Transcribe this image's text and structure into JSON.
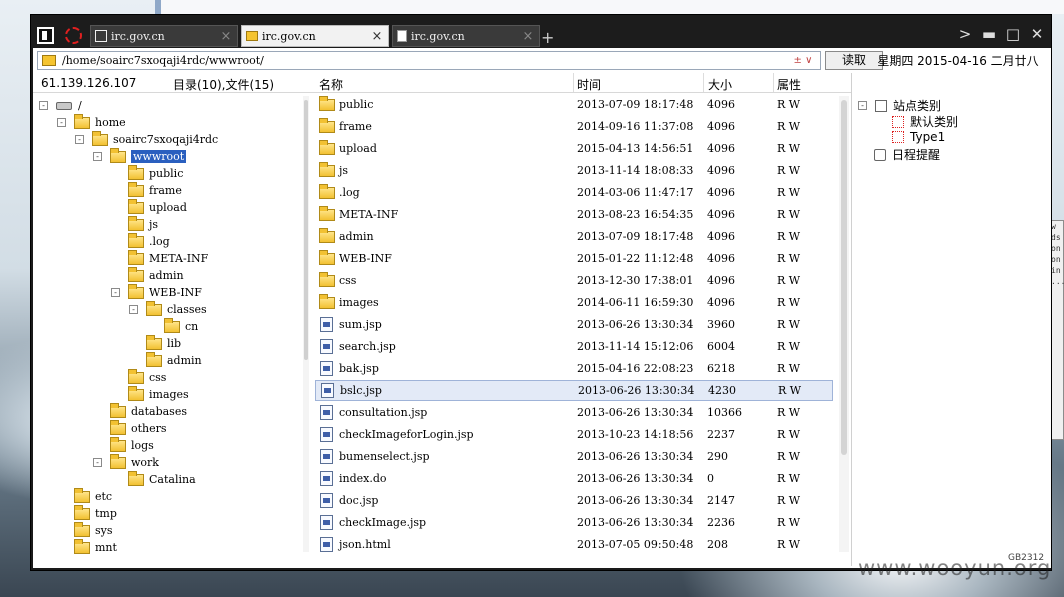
{
  "window": {
    "tabs": [
      {
        "label": "irc.gov.cn"
      },
      {
        "label": "irc.gov.cn"
      },
      {
        "label": "irc.gov.cn"
      }
    ],
    "add_tab": "+",
    "controls": {
      "prev": ">",
      "minimize": "▬",
      "maximize": "□",
      "close": "✕"
    }
  },
  "address": {
    "path": "/home/soairc7sxoqaji4rdc/wwwroot/",
    "dropdown": "± ∨",
    "read_button": "读取",
    "date": "星期四 2015-04-16 二月廿八"
  },
  "status": {
    "ip": "61.139.126.107",
    "counts": "目录(10),文件(15)"
  },
  "columns": {
    "name": "名称",
    "time": "时间",
    "size": "大小",
    "attr": "属性"
  },
  "tree": [
    {
      "label": "/",
      "kind": "drive",
      "level": 0,
      "toggle": "-"
    },
    {
      "label": "home",
      "kind": "folder",
      "level": 1,
      "toggle": "-"
    },
    {
      "label": "soairc7sxoqaji4rdc",
      "kind": "folder",
      "level": 2,
      "toggle": "-"
    },
    {
      "label": "wwwroot",
      "kind": "folder",
      "level": 3,
      "toggle": "-",
      "selected": true
    },
    {
      "label": "public",
      "kind": "folder",
      "level": 4
    },
    {
      "label": "frame",
      "kind": "folder",
      "level": 4
    },
    {
      "label": "upload",
      "kind": "folder",
      "level": 4
    },
    {
      "label": "js",
      "kind": "folder",
      "level": 4
    },
    {
      "label": ".log",
      "kind": "folder",
      "level": 4
    },
    {
      "label": "META-INF",
      "kind": "folder",
      "level": 4
    },
    {
      "label": "admin",
      "kind": "folder",
      "level": 4
    },
    {
      "label": "WEB-INF",
      "kind": "folder",
      "level": 4,
      "toggle": "-"
    },
    {
      "label": "classes",
      "kind": "folder",
      "level": 5,
      "toggle": "-"
    },
    {
      "label": "cn",
      "kind": "folder",
      "level": 6
    },
    {
      "label": "lib",
      "kind": "folder",
      "level": 5
    },
    {
      "label": "admin",
      "kind": "folder",
      "level": 5
    },
    {
      "label": "css",
      "kind": "folder",
      "level": 4
    },
    {
      "label": "images",
      "kind": "folder",
      "level": 4
    },
    {
      "label": "databases",
      "kind": "folder",
      "level": 3
    },
    {
      "label": "others",
      "kind": "folder",
      "level": 3
    },
    {
      "label": "logs",
      "kind": "folder",
      "level": 3
    },
    {
      "label": "work",
      "kind": "folder",
      "level": 3,
      "toggle": "-"
    },
    {
      "label": "Catalina",
      "kind": "folder",
      "level": 4
    },
    {
      "label": "etc",
      "kind": "folder",
      "level": 1
    },
    {
      "label": "tmp",
      "kind": "folder",
      "level": 1
    },
    {
      "label": "sys",
      "kind": "folder",
      "level": 1
    },
    {
      "label": "mnt",
      "kind": "folder",
      "level": 1
    }
  ],
  "files": [
    {
      "name": "public",
      "kind": "folder",
      "time": "2013-07-09 18:17:48",
      "size": "4096",
      "attr": "R W"
    },
    {
      "name": "frame",
      "kind": "folder",
      "time": "2014-09-16 11:37:08",
      "size": "4096",
      "attr": "R W"
    },
    {
      "name": "upload",
      "kind": "folder",
      "time": "2015-04-13 14:56:51",
      "size": "4096",
      "attr": "R W"
    },
    {
      "name": "js",
      "kind": "folder",
      "time": "2013-11-14 18:08:33",
      "size": "4096",
      "attr": "R W"
    },
    {
      "name": ".log",
      "kind": "folder",
      "time": "2014-03-06 11:47:17",
      "size": "4096",
      "attr": "R W"
    },
    {
      "name": "META-INF",
      "kind": "folder",
      "time": "2013-08-23 16:54:35",
      "size": "4096",
      "attr": "R W"
    },
    {
      "name": "admin",
      "kind": "folder",
      "time": "2013-07-09 18:17:48",
      "size": "4096",
      "attr": "R W"
    },
    {
      "name": "WEB-INF",
      "kind": "folder",
      "time": "2015-01-22 11:12:48",
      "size": "4096",
      "attr": "R W"
    },
    {
      "name": "css",
      "kind": "folder",
      "time": "2013-12-30 17:38:01",
      "size": "4096",
      "attr": "R W"
    },
    {
      "name": "images",
      "kind": "folder",
      "time": "2014-06-11 16:59:30",
      "size": "4096",
      "attr": "R W"
    },
    {
      "name": "sum.jsp",
      "kind": "file",
      "time": "2013-06-26 13:30:34",
      "size": "3960",
      "attr": "R W"
    },
    {
      "name": "search.jsp",
      "kind": "file",
      "time": "2013-11-14 15:12:06",
      "size": "6004",
      "attr": "R W"
    },
    {
      "name": "bak.jsp",
      "kind": "file",
      "time": "2015-04-16 22:08:23",
      "size": "6218",
      "attr": "R W"
    },
    {
      "name": "bslc.jsp",
      "kind": "file",
      "time": "2013-06-26 13:30:34",
      "size": "4230",
      "attr": "R W",
      "selected": true
    },
    {
      "name": "consultation.jsp",
      "kind": "file",
      "time": "2013-06-26 13:30:34",
      "size": "10366",
      "attr": "R W"
    },
    {
      "name": "checkImageforLogin.jsp",
      "kind": "file",
      "time": "2013-10-23 14:18:56",
      "size": "2237",
      "attr": "R W"
    },
    {
      "name": "bumenselect.jsp",
      "kind": "file",
      "time": "2013-06-26 13:30:34",
      "size": "290",
      "attr": "R W"
    },
    {
      "name": "index.do",
      "kind": "file",
      "time": "2013-06-26 13:30:34",
      "size": "0",
      "attr": "R W"
    },
    {
      "name": "doc.jsp",
      "kind": "file",
      "time": "2013-06-26 13:30:34",
      "size": "2147",
      "attr": "R W"
    },
    {
      "name": "checkImage.jsp",
      "kind": "file",
      "time": "2013-06-26 13:30:34",
      "size": "2236",
      "attr": "R W"
    },
    {
      "name": "json.html",
      "kind": "file",
      "time": "2013-07-05 09:50:48",
      "size": "208",
      "attr": "R W"
    }
  ],
  "categories": {
    "site_category": "站点类别",
    "default_category": "默认类别",
    "type1": "Type1",
    "schedule": "日程提醒"
  },
  "desktop": {
    "watermark": "www.wooyun.org",
    "gb_label": "GB2312",
    "side_lines": [
      "w",
      "ds",
      "",
      "",
      "on",
      "on",
      "in",
      "..."
    ]
  }
}
